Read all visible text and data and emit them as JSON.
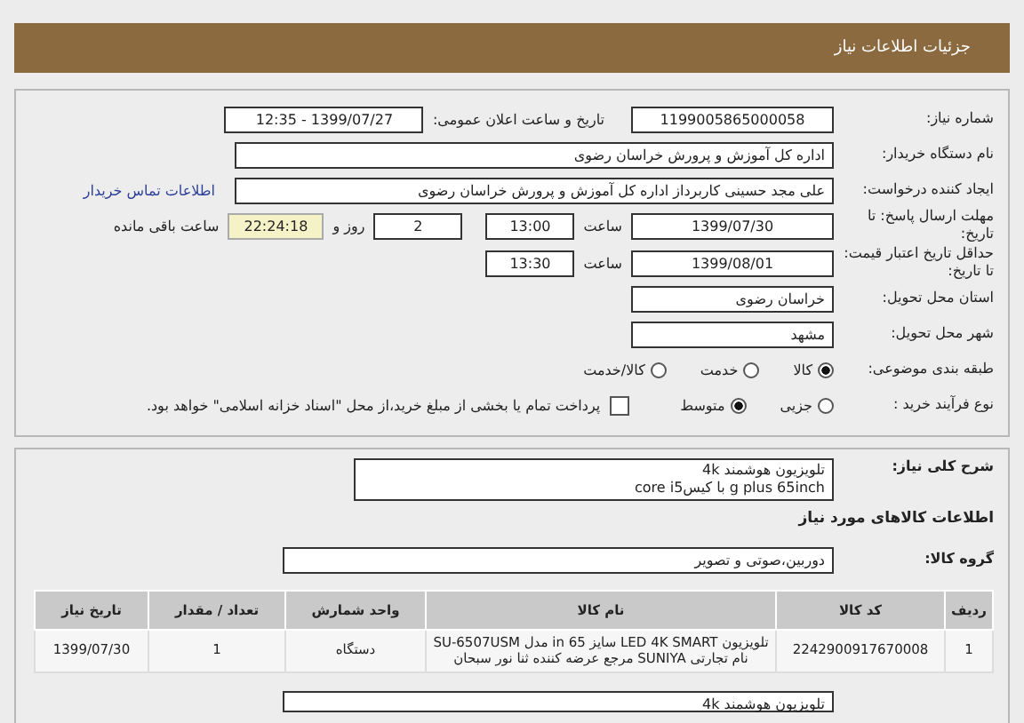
{
  "header": {
    "title": "جزئیات اطلاعات نیاز"
  },
  "need_number": {
    "label": "شماره نیاز:",
    "value": "1199005865000058"
  },
  "announce": {
    "label": "تاریخ و ساعت اعلان عمومی:",
    "value": "1399/07/27 - 12:35"
  },
  "buyer": {
    "label": "نام دستگاه خریدار:",
    "value": "اداره کل آموزش و پرورش خراسان رضوی"
  },
  "creator": {
    "label": "ایجاد کننده درخواست:",
    "value": "علی مجد حسینی کاربرداز اداره کل آموزش و پرورش خراسان رضوی",
    "link": "اطلاعات تماس خریدار"
  },
  "deadline": {
    "label": "مهلت ارسال پاسخ: تا تاریخ:",
    "date": "1399/07/30",
    "time_label": "ساعت",
    "time": "13:00",
    "days": "2",
    "days_label": "روز و",
    "remaining": "22:24:18",
    "remaining_label": "ساعت باقی مانده"
  },
  "validity": {
    "label": "حداقل تاریخ اعتبار قیمت: تا تاریخ:",
    "date": "1399/08/01",
    "time_label": "ساعت",
    "time": "13:30"
  },
  "province": {
    "label": "استان محل تحویل:",
    "value": "خراسان رضوی"
  },
  "city": {
    "label": "شهر محل تحویل:",
    "value": "مشهد"
  },
  "category": {
    "label": "طبقه بندی موضوعی:",
    "options": [
      {
        "label": "کالا",
        "selected": true
      },
      {
        "label": "خدمت",
        "selected": false
      },
      {
        "label": "کالا/خدمت",
        "selected": false
      }
    ]
  },
  "process": {
    "label": "نوع فرآیند خرید :",
    "options": [
      {
        "label": "جزیی",
        "selected": false
      },
      {
        "label": "متوسط",
        "selected": true
      }
    ],
    "treasury": {
      "label": "پرداخت تمام یا بخشی از مبلغ خرید،از محل \"اسناد خزانه اسلامی\" خواهد بود.",
      "checked": false
    }
  },
  "description": {
    "label": "شرح کلی نیاز:",
    "lines": [
      "تلویزیون هوشمند 4k",
      "g plus 65inch با کیسcore i5"
    ]
  },
  "items_heading": "اطلاعات کالاهای مورد نیاز",
  "group": {
    "label": "گروه کالا:",
    "value": "دوربین،صوتی و تصویر"
  },
  "table": {
    "columns": [
      "ردیف",
      "کد کالا",
      "نام کالا",
      "واحد شمارش",
      "تعداد / مقدار",
      "تاریخ نیاز"
    ],
    "rows": [
      [
        "1",
        "2242900917670008",
        "تلویزیون LED 4K SMART سایز 65 in مدل SU-6507USM نام تجارتی SUNIYA مرجع عرضه کننده ثنا نور سبحان",
        "دستگاه",
        "1",
        "1399/07/30"
      ]
    ]
  },
  "bottom_field": {
    "value": "تلویزیون هوشمند 4k"
  }
}
